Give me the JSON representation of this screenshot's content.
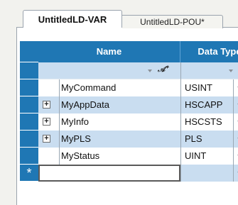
{
  "tabs": [
    {
      "label": "UntitledLD-VAR",
      "active": true
    },
    {
      "label": "UntitledLD-POU*",
      "active": false
    }
  ],
  "grid": {
    "columns": [
      "Name",
      "Data Type"
    ],
    "filter_icon": "filter-icon",
    "rows": [
      {
        "name": "MyCommand",
        "type": "USINT",
        "expandable": false
      },
      {
        "name": "MyAppData",
        "type": "HSCAPP",
        "expandable": true
      },
      {
        "name": "MyInfo",
        "type": "HSCSTS",
        "expandable": true
      },
      {
        "name": "MyPLS",
        "type": "PLS",
        "expandable": true
      },
      {
        "name": "MyStatus",
        "type": "UINT",
        "expandable": false
      }
    ],
    "new_row_marker": "*",
    "expand_glyph": "+"
  },
  "colors": {
    "header_blue": "#1f77b4",
    "row_blue": "#c9ddf0",
    "row_white": "#ffffff",
    "panel_bg": "#f2f2ee"
  }
}
